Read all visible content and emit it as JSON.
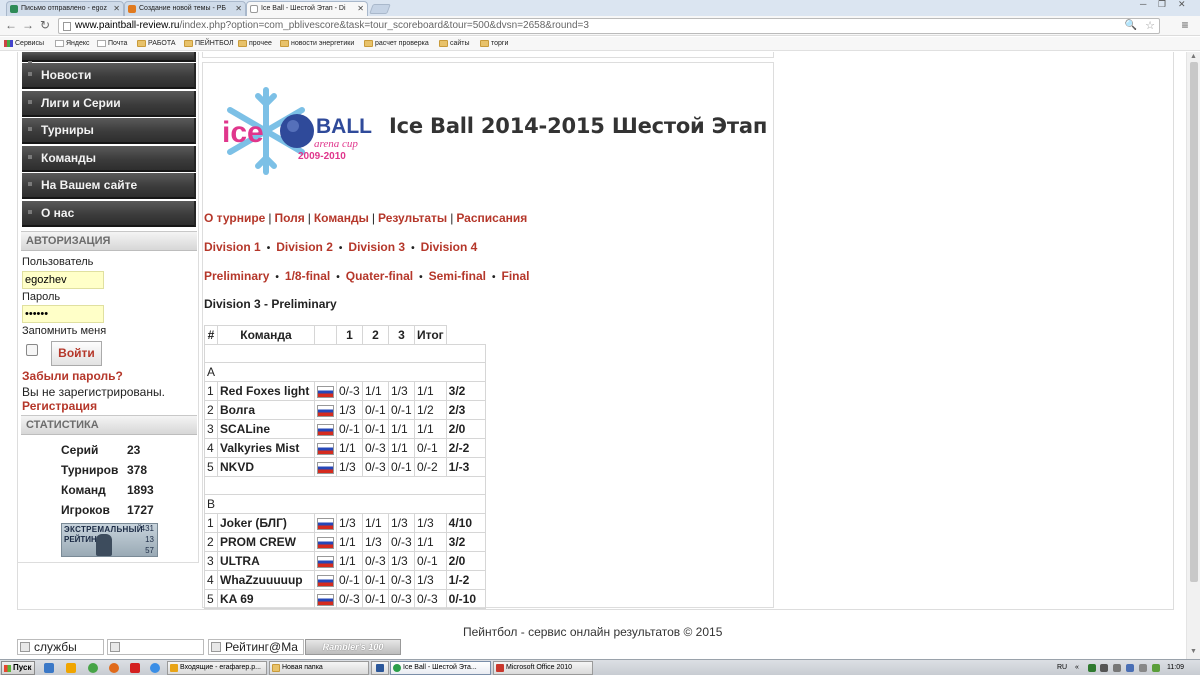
{
  "browser": {
    "tabs": [
      {
        "title": "Письмо отправлено - egoz",
        "active": false
      },
      {
        "title": "Создание новой темы - РБ",
        "active": false
      },
      {
        "title": "Ice Ball - Шестой Этап - Di",
        "active": true
      }
    ],
    "url_domain": "www.paintball-review.ru",
    "url_path": "/index.php?option=com_pblivescore&task=tour_scoreboard&tour=500&dvsn=2658&round=3",
    "bookmarks": [
      "Сервисы",
      "Яндекс",
      "Почта",
      "РАБОТА",
      "ПЕЙНТБОЛ",
      "прочее",
      "новости энергетики",
      "расчет проверка",
      "сайты",
      "торги"
    ]
  },
  "sidebar": {
    "menu": [
      "Новости",
      "Лиги и Серии",
      "Турниры",
      "Команды",
      "На Вашем сайте",
      "О нас"
    ],
    "auth": {
      "title": "АВТОРИЗАЦИЯ",
      "username_label": "Пользователь",
      "username_value": "egozhev",
      "password_label": "Пароль",
      "password_value": "••••••",
      "remember_label": "Запомнить меня",
      "login_button": "Войти",
      "forgot_link": "Забыли пароль?",
      "not_registered": "Вы не зарегистрированы.",
      "register_link": "Регистрация"
    },
    "stats": {
      "title": "СТАТИСТИКА",
      "rows": [
        {
          "label": "Серий",
          "value": "23"
        },
        {
          "label": "Турниров",
          "value": "378"
        },
        {
          "label": "Команд",
          "value": "1893"
        },
        {
          "label": "Игроков",
          "value": "1727"
        }
      ]
    },
    "rating_banner": {
      "line1": "ЭКСТРЕМАЛЬНЫЙ",
      "line2": "РЕЙТИНГ",
      "n1": "431",
      "n2": "13",
      "n3": "57"
    }
  },
  "main": {
    "logo": {
      "word1": "ice",
      "word2": "BALL",
      "tagline": "arena cup",
      "years": "2009-2010"
    },
    "title": "Ice Ball  2014-2015  Шестой Этап",
    "nav_links": [
      "О турнире",
      "Поля",
      "Команды",
      "Результаты",
      "Расписания"
    ],
    "divisions": [
      "Division 1",
      "Division 2",
      "Division 3",
      "Division 4"
    ],
    "rounds": [
      "Preliminary",
      "1/8-final",
      "Quater-final",
      "Semi-final",
      "Final"
    ],
    "subtitle": "Division 3 - Preliminary",
    "table": {
      "headers": [
        "#",
        "Команда",
        "",
        "1",
        "2",
        "3",
        "Итог"
      ],
      "groups": [
        {
          "name": "A",
          "rows": [
            {
              "n": "1",
              "team": "Red Foxes light",
              "g1": "0/-3",
              "g2": "1/1",
              "g3": "1/3",
              "g4": "1/1",
              "total": "3/2"
            },
            {
              "n": "2",
              "team": "Волга",
              "g1": "1/3",
              "g2": "0/-1",
              "g3": "0/-1",
              "g4": "1/2",
              "total": "2/3"
            },
            {
              "n": "3",
              "team": "SCALine",
              "g1": "0/-1",
              "g2": "0/-1",
              "g3": "1/1",
              "g4": "1/1",
              "total": "2/0"
            },
            {
              "n": "4",
              "team": "Valkyries Mist",
              "g1": "1/1",
              "g2": "0/-3",
              "g3": "1/1",
              "g4": "0/-1",
              "total": "2/-2"
            },
            {
              "n": "5",
              "team": "NKVD",
              "g1": "1/3",
              "g2": "0/-3",
              "g3": "0/-1",
              "g4": "0/-2",
              "total": "1/-3"
            }
          ]
        },
        {
          "name": "B",
          "rows": [
            {
              "n": "1",
              "team": "Joker (БЛГ)",
              "g1": "1/3",
              "g2": "1/1",
              "g3": "1/3",
              "g4": "1/3",
              "total": "4/10"
            },
            {
              "n": "2",
              "team": "PROM CREW",
              "g1": "1/1",
              "g2": "1/3",
              "g3": "0/-3",
              "g4": "1/1",
              "total": "3/2"
            },
            {
              "n": "3",
              "team": "ULTRA",
              "g1": "1/1",
              "g2": "0/-3",
              "g3": "1/3",
              "g4": "0/-1",
              "total": "2/0"
            },
            {
              "n": "4",
              "team": "WhaZzuuuuup",
              "g1": "0/-1",
              "g2": "0/-1",
              "g3": "0/-3",
              "g4": "1/3",
              "total": "1/-2"
            },
            {
              "n": "5",
              "team": "KA 69",
              "g1": "0/-3",
              "g2": "0/-1",
              "g3": "0/-3",
              "g4": "0/-3",
              "total": "0/-10"
            }
          ]
        }
      ]
    }
  },
  "footer": {
    "text": "Пейнтбол - сервис онлайн результатов © 2015",
    "counters": [
      "службы",
      "",
      "Рейтинг@Ma"
    ],
    "rambler": "Rambler's 100"
  },
  "taskbar": {
    "start": "Пуск",
    "tasks": [
      {
        "label": "Входящие - eraфarep.p...",
        "active": false
      },
      {
        "label": "Новая папка",
        "active": false
      },
      {
        "label": "",
        "active": false
      },
      {
        "label": "Ice Ball - Шестой Эта...",
        "active": true
      },
      {
        "label": "Microsoft Office 2010",
        "active": false
      }
    ],
    "lang": "RU",
    "time": "11:09"
  },
  "colors": {
    "link_red": "#b5372a",
    "menu_dark": "#3c3c3c",
    "input_yellow": "#ffffc8"
  }
}
